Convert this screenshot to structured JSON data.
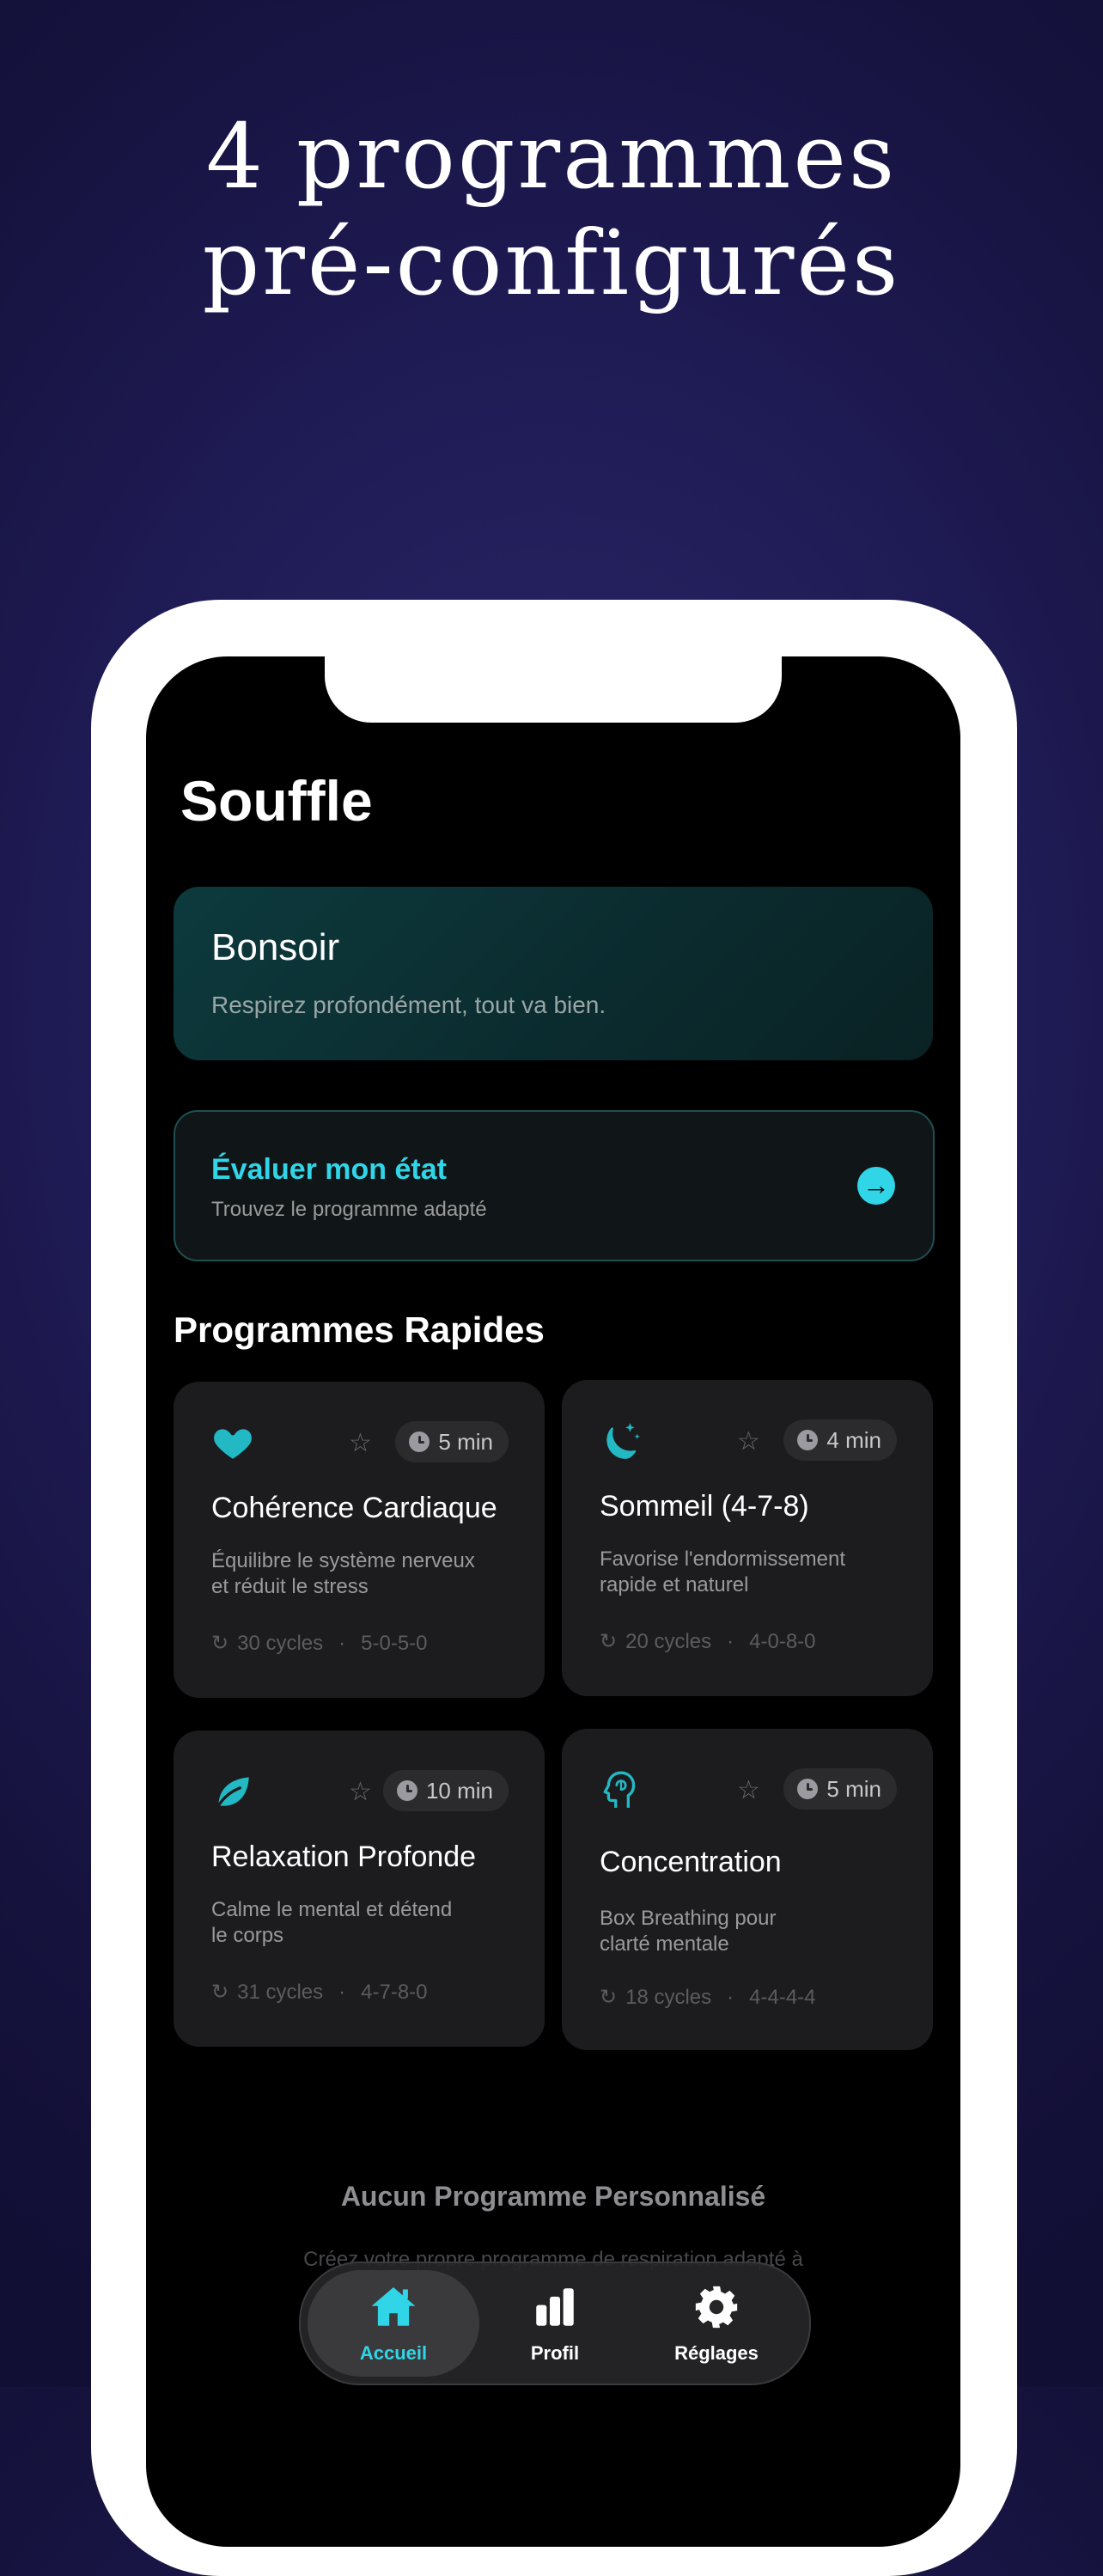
{
  "headline": {
    "line1": "4 programmes",
    "line2": "pré-configurés"
  },
  "app": {
    "title": "Souffle",
    "greeting": {
      "title": "Bonsoir",
      "subtitle": "Respirez profondément, tout va bien."
    },
    "evaluate": {
      "title": "Évaluer mon état",
      "subtitle": "Trouvez le programme adapté",
      "arrow_icon": "arrow-right-icon"
    },
    "section_title": "Programmes Rapides",
    "programs": [
      {
        "icon": "heart-icon",
        "duration": "5 min",
        "title": "Cohérence Cardiaque",
        "desc_line1": "Équilibre le système nerveux",
        "desc_line2": "et réduit le stress",
        "cycles": "30 cycles",
        "pattern": "5-0-5-0"
      },
      {
        "icon": "moon-stars-icon",
        "duration": "4 min",
        "title": "Sommeil (4-7-8)",
        "desc_line1": "Favorise l'endormissement",
        "desc_line2": "rapide et naturel",
        "cycles": "20 cycles",
        "pattern": "4-0-8-0"
      },
      {
        "icon": "leaf-icon",
        "duration": "10 min",
        "title": "Relaxation Profonde",
        "desc_line1": "Calme le mental et détend",
        "desc_line2": "le corps",
        "cycles": "31 cycles",
        "pattern": "4-7-8-0"
      },
      {
        "icon": "brain-head-icon",
        "duration": "5 min",
        "title": "Concentration",
        "desc_line1": "Box Breathing pour",
        "desc_line2": "clarté mentale",
        "cycles": "18 cycles",
        "pattern": "4-4-4-4"
      }
    ],
    "empty": {
      "title": "Aucun Programme Personnalisé",
      "subtitle": "Créez votre propre programme de respiration adapté à"
    },
    "tabs": [
      {
        "label": "Accueil",
        "icon": "house-icon",
        "active": true
      },
      {
        "label": "Profil",
        "icon": "bar-chart-icon",
        "active": false
      },
      {
        "label": "Réglages",
        "icon": "gear-icon",
        "active": false
      }
    ]
  },
  "colors": {
    "accent": "#30d5e8",
    "icon_teal": "#22b8c4",
    "card_bg": "#1c1c1e",
    "background": "#1f1b55"
  }
}
